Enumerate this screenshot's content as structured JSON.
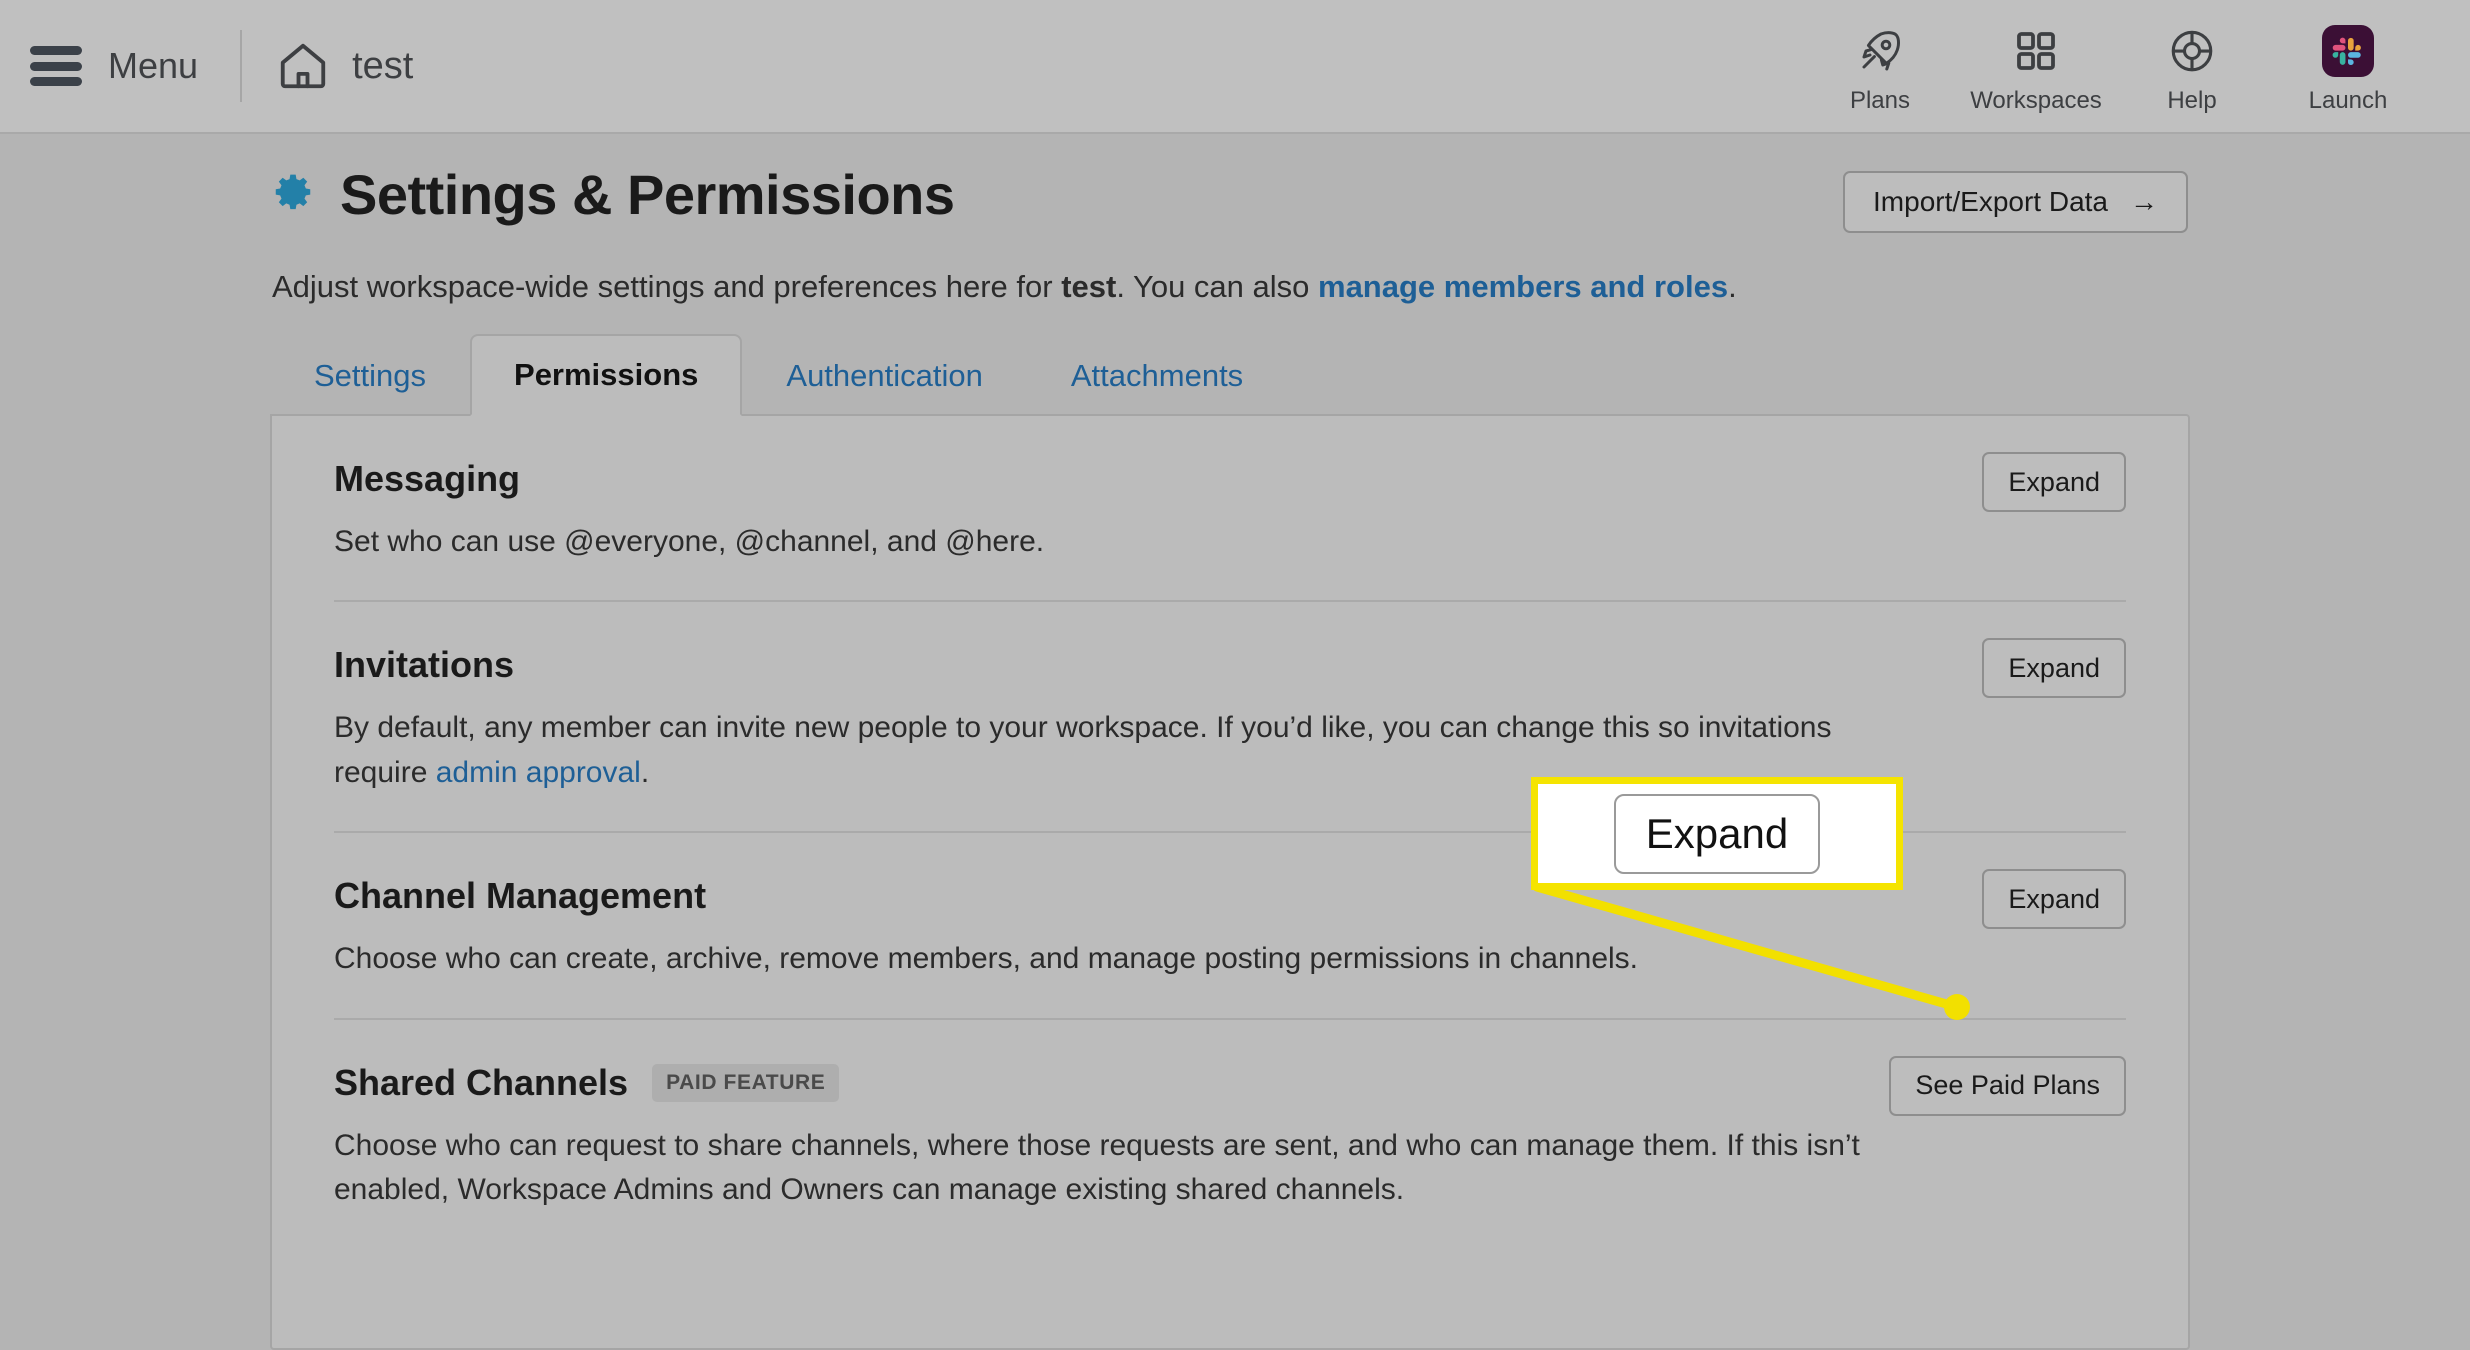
{
  "topbar": {
    "menu_label": "Menu",
    "workspace_name": "test",
    "nav": [
      {
        "label": "Plans",
        "icon": "rocket-icon"
      },
      {
        "label": "Workspaces",
        "icon": "grid-icon"
      },
      {
        "label": "Help",
        "icon": "lifebuoy-icon"
      },
      {
        "label": "Launch",
        "icon": "slack-logo-icon"
      }
    ]
  },
  "header": {
    "title": "Settings & Permissions",
    "gear_icon_color": "#2380a8",
    "import_export_label": "Import/Export Data",
    "import_export_arrow": "→",
    "subtitle_part1": "Adjust workspace-wide settings and preferences here for ",
    "subtitle_workspace": "test",
    "subtitle_part2": ". You can also ",
    "subtitle_link": "manage members and roles",
    "subtitle_end": "."
  },
  "tabs": [
    {
      "label": "Settings",
      "active": false
    },
    {
      "label": "Permissions",
      "active": true
    },
    {
      "label": "Authentication",
      "active": false
    },
    {
      "label": "Attachments",
      "active": false
    }
  ],
  "sections": [
    {
      "title": "Messaging",
      "badge": "",
      "desc": "Set who can use @everyone, @channel, and @here.",
      "button": "Expand"
    },
    {
      "title": "Invitations",
      "badge": "",
      "desc_part1": "By default, any member can invite new people to your workspace. If you’d like, you can change this so invitations require ",
      "desc_link": "admin approval",
      "desc_part2": ".",
      "button": "Expand"
    },
    {
      "title": "Channel Management",
      "badge": "",
      "desc": "Choose who can create, archive, remove members, and manage posting permissions in channels.",
      "button": "Expand"
    },
    {
      "title": "Shared Channels",
      "badge": "PAID FEATURE",
      "desc": "Choose who can request to share channels, where those requests are sent, and who can manage them. If this isn’t enabled, Workspace Admins and Owners can manage existing shared channels.",
      "button": "See Paid Plans"
    }
  ],
  "callout": {
    "button_label": "Expand",
    "border_color": "#f5e400",
    "fill_color": "#ffffff",
    "connector_color": "#f2e000"
  }
}
